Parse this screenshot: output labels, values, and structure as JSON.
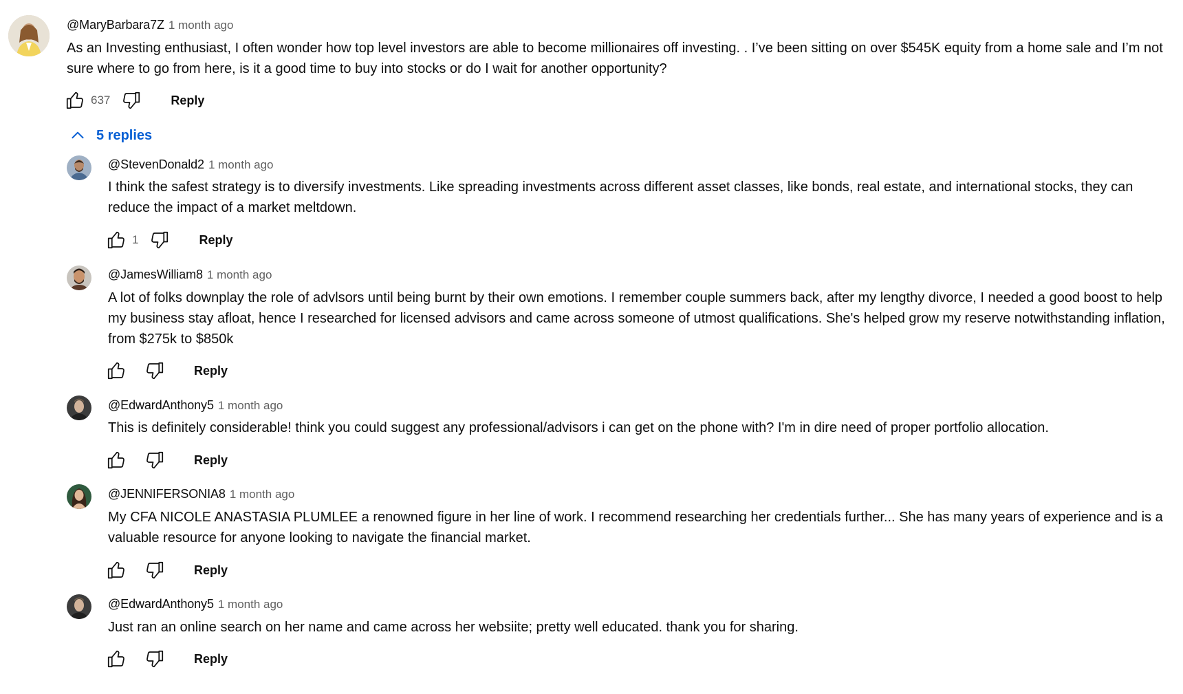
{
  "thread": {
    "top": {
      "author": "@MaryBarbara7Z",
      "time": "1 month ago",
      "text": "As an Investing enthusiast, I often wonder how top level investors are able to become millionaires off investing. . I’ve been sitting on over $545K equity from a home sale and I’m not sure where to go from here, is it a good time to buy into stocks or do I wait for another opportunity?",
      "likes": "637",
      "reply_label": "Reply"
    },
    "replies_toggle": "5 replies",
    "replies": [
      {
        "author": "@StevenDonald2",
        "time": "1 month ago",
        "text": "I think the safest strategy is to diversify investments. Like spreading investments across different asset classes, like bonds, real estate, and international stocks, they can reduce the impact of a market meltdown.",
        "likes": "1",
        "reply_label": "Reply"
      },
      {
        "author": "@JamesWilliam8",
        "time": "1 month ago",
        "text": "A lot of folks downplay the role of advlsors until being burnt by their own emotions. I remember couple summers back, after my lengthy divorce, I needed a good boost to help my business stay afloat, hence I researched for licensed advisors and came across someone of utmost qualifications. She's helped grow my reserve notwithstanding inflation, from $275k to $850k",
        "likes": "",
        "reply_label": "Reply"
      },
      {
        "author": "@EdwardAnthony5",
        "time": "1 month ago",
        "text": "This is definitely considerable! think you could suggest any professional/advisors i can get on the phone with? I'm in dire need of proper portfolio allocation.",
        "likes": "",
        "reply_label": "Reply"
      },
      {
        "author": "@JENNIFERSONIA8",
        "time": "1 month ago",
        "text": "My CFA  NICOLE ANASTASIA PLUMLEE  a renowned figure in her line of work. I recommend researching her credentials further... She has many years of experience and is a valuable resource for anyone looking to navigate the financial market.",
        "likes": "",
        "reply_label": "Reply"
      },
      {
        "author": "@EdwardAnthony5",
        "time": "1 month ago",
        "text": "Just ran an online search on her name and came across her websiite; pretty well educated. thank you for sharing.",
        "likes": "",
        "reply_label": "Reply"
      }
    ]
  },
  "icons": {
    "like": "thumbs-up-icon",
    "dislike": "thumbs-down-icon",
    "collapse": "chevron-up-icon"
  },
  "colors": {
    "link_blue": "#065fd4",
    "meta_gray": "#606060",
    "text": "#0f0f0f"
  }
}
